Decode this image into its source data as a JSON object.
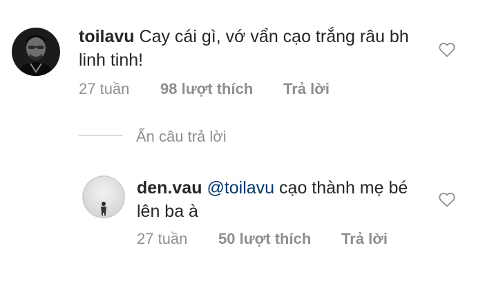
{
  "comments": [
    {
      "username": "toilavu",
      "mention": "",
      "text": "Cay cái gì, vớ vẩn cạo trắng râu bh linh tinh!",
      "time": "27 tuần",
      "likes": "98 lượt thích",
      "reply_label": "Trả lời",
      "like_icon": "heart-outline-icon"
    },
    {
      "username": "den.vau",
      "mention": "@toilavu",
      "text": "cạo thành mẹ bé lên ba à",
      "time": "27 tuần",
      "likes": "50 lượt thích",
      "reply_label": "Trả lời",
      "like_icon": "heart-outline-icon"
    }
  ],
  "hide_replies_label": "Ẩn câu trả lời"
}
